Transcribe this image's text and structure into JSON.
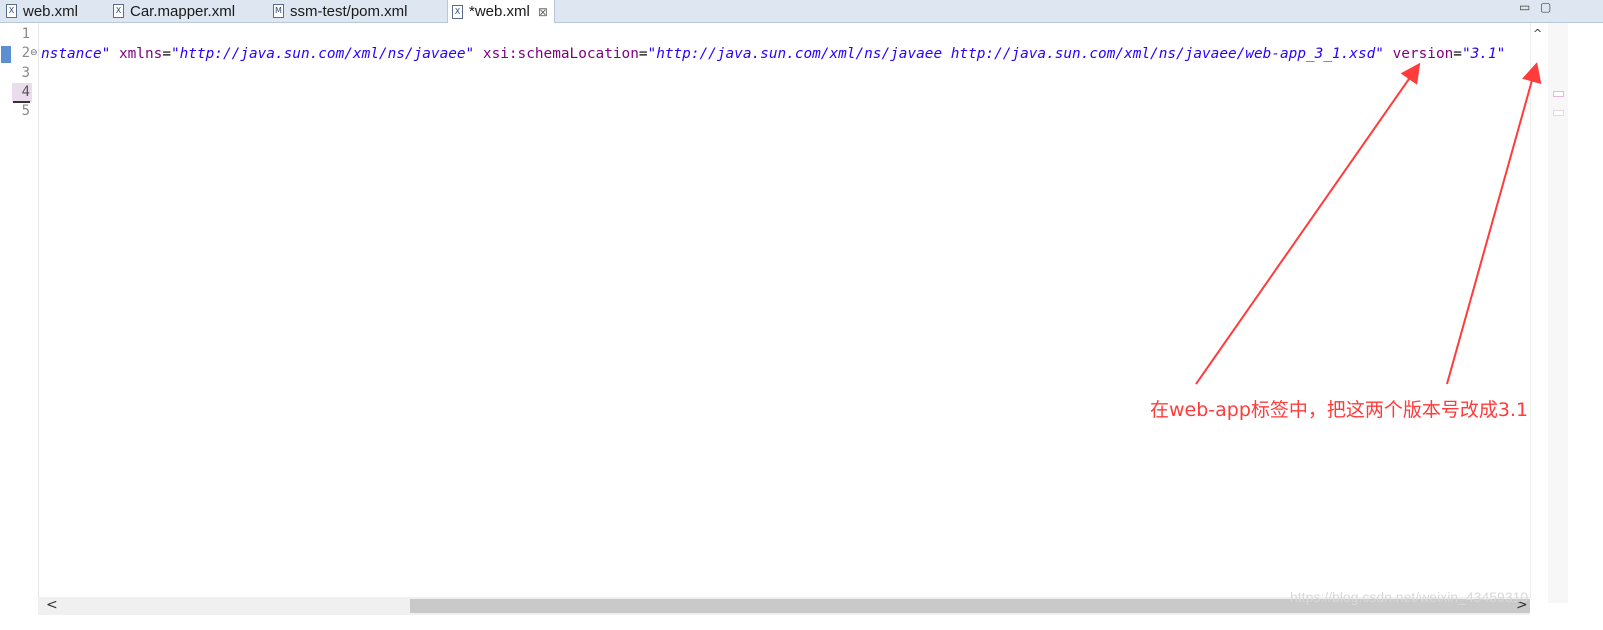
{
  "tabs": [
    {
      "label": "web.xml",
      "icon": "X",
      "active": false
    },
    {
      "label": "Car.mapper.xml",
      "icon": "X",
      "active": false
    },
    {
      "label": "ssm-test/pom.xml",
      "icon": "M",
      "active": false
    },
    {
      "label": "*web.xml",
      "icon": "X",
      "active": true,
      "close": "⊠"
    }
  ],
  "window_controls": {
    "minimize": "▭",
    "maximize": "▢"
  },
  "editor": {
    "line_numbers": [
      "1",
      "2",
      "3",
      "4",
      "5"
    ],
    "fold_marker": "⊖",
    "line2": {
      "segments": [
        {
          "text": "nstance\"",
          "kind": "val"
        },
        {
          "text": " ",
          "kind": "eq"
        },
        {
          "text": "xmlns",
          "kind": "attr"
        },
        {
          "text": "=",
          "kind": "eq"
        },
        {
          "text": "\"http://java.sun.com/xml/ns/javaee\"",
          "kind": "val"
        },
        {
          "text": " ",
          "kind": "eq"
        },
        {
          "text": "xsi:schemaLocation",
          "kind": "attr"
        },
        {
          "text": "=",
          "kind": "eq"
        },
        {
          "text": "\"http://java.sun.com/xml/ns/javaee http://java.sun.com/xml/ns/javaee/web-app_3_1.xsd\"",
          "kind": "val"
        },
        {
          "text": " ",
          "kind": "eq"
        },
        {
          "text": "version",
          "kind": "attr"
        },
        {
          "text": "=",
          "kind": "eq"
        },
        {
          "text": "\"3.1\"",
          "kind": "val"
        }
      ]
    }
  },
  "annotation": {
    "text": "在web-app标签中，把这两个版本号改成3.1",
    "color": "#ff3b3b"
  },
  "watermark": "https://blog.csdn.net/weixin_43459310",
  "scroll": {
    "left_arrow": "<",
    "right_arrow": ">",
    "up_arrow": "^"
  },
  "colors": {
    "attr": "#7f007f",
    "value": "#2a00ff",
    "tabbar": "#dde6f1"
  }
}
